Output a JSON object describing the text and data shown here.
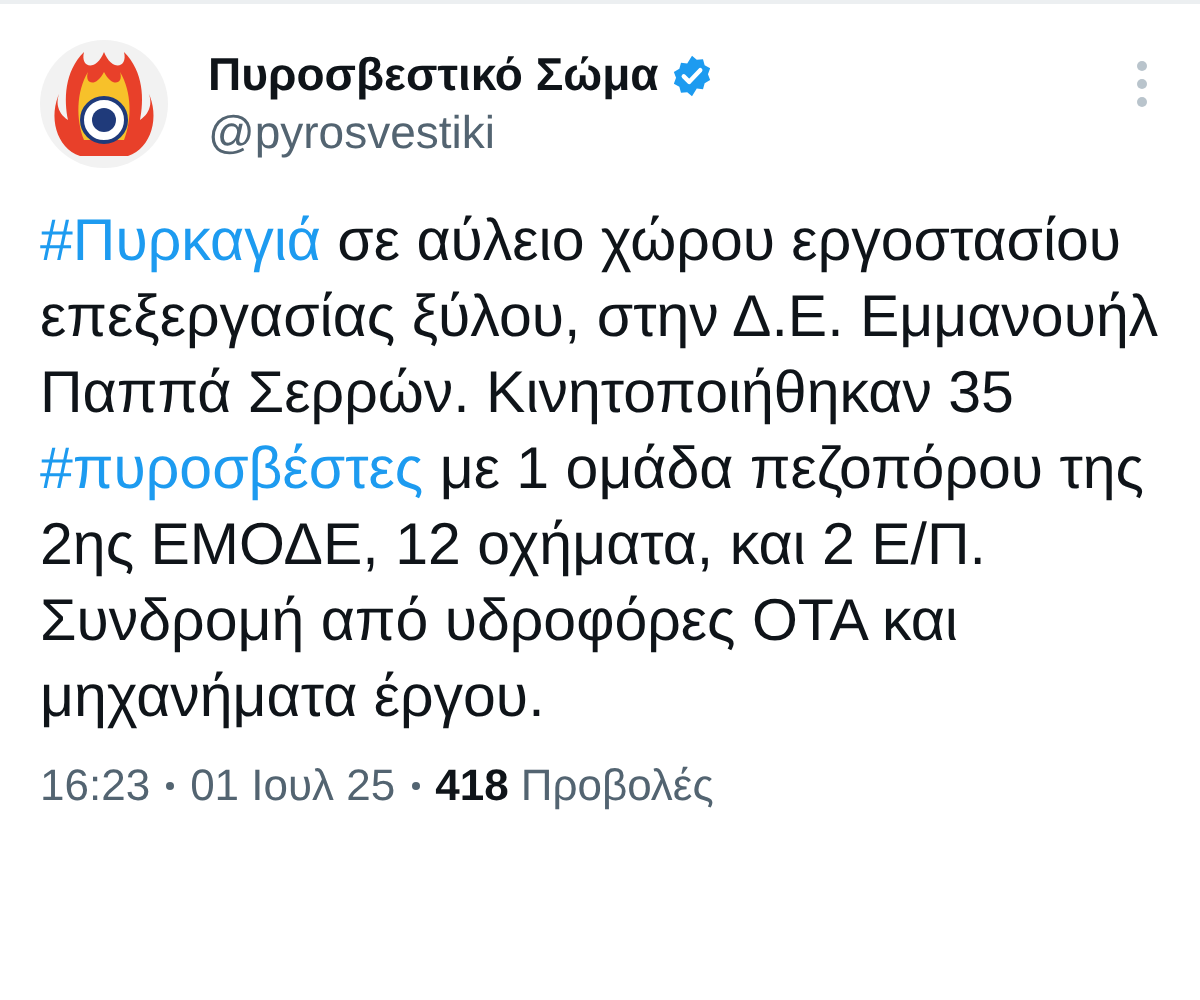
{
  "author": {
    "name": "Πυροσβεστικό Σώμα",
    "handle": "@pyrosvestiki",
    "verified": true
  },
  "body": [
    {
      "kind": "hashtag",
      "text": "#Πυρκαγιά"
    },
    {
      "kind": "text",
      "text": " σε αύλειο χώρου εργοστασίου επεξεργασίας ξύλου, στην Δ.Ε. Εμμανουήλ Παππά Σερρών. Κινητοποιήθηκαν 35 "
    },
    {
      "kind": "hashtag",
      "text": "#πυροσβέστες"
    },
    {
      "kind": "text",
      "text": " με 1 ομάδα πεζοπόρου της 2ης ΕΜΟΔΕ, 12 οχήματα, και 2 Ε/Π. Συνδρομή από υδροφόρες ΟΤΑ και μηχανήματα έργου."
    }
  ],
  "meta": {
    "time": "16:23",
    "date": "01 Ιουλ 25",
    "views_count": "418",
    "views_label": "Προβολές"
  }
}
